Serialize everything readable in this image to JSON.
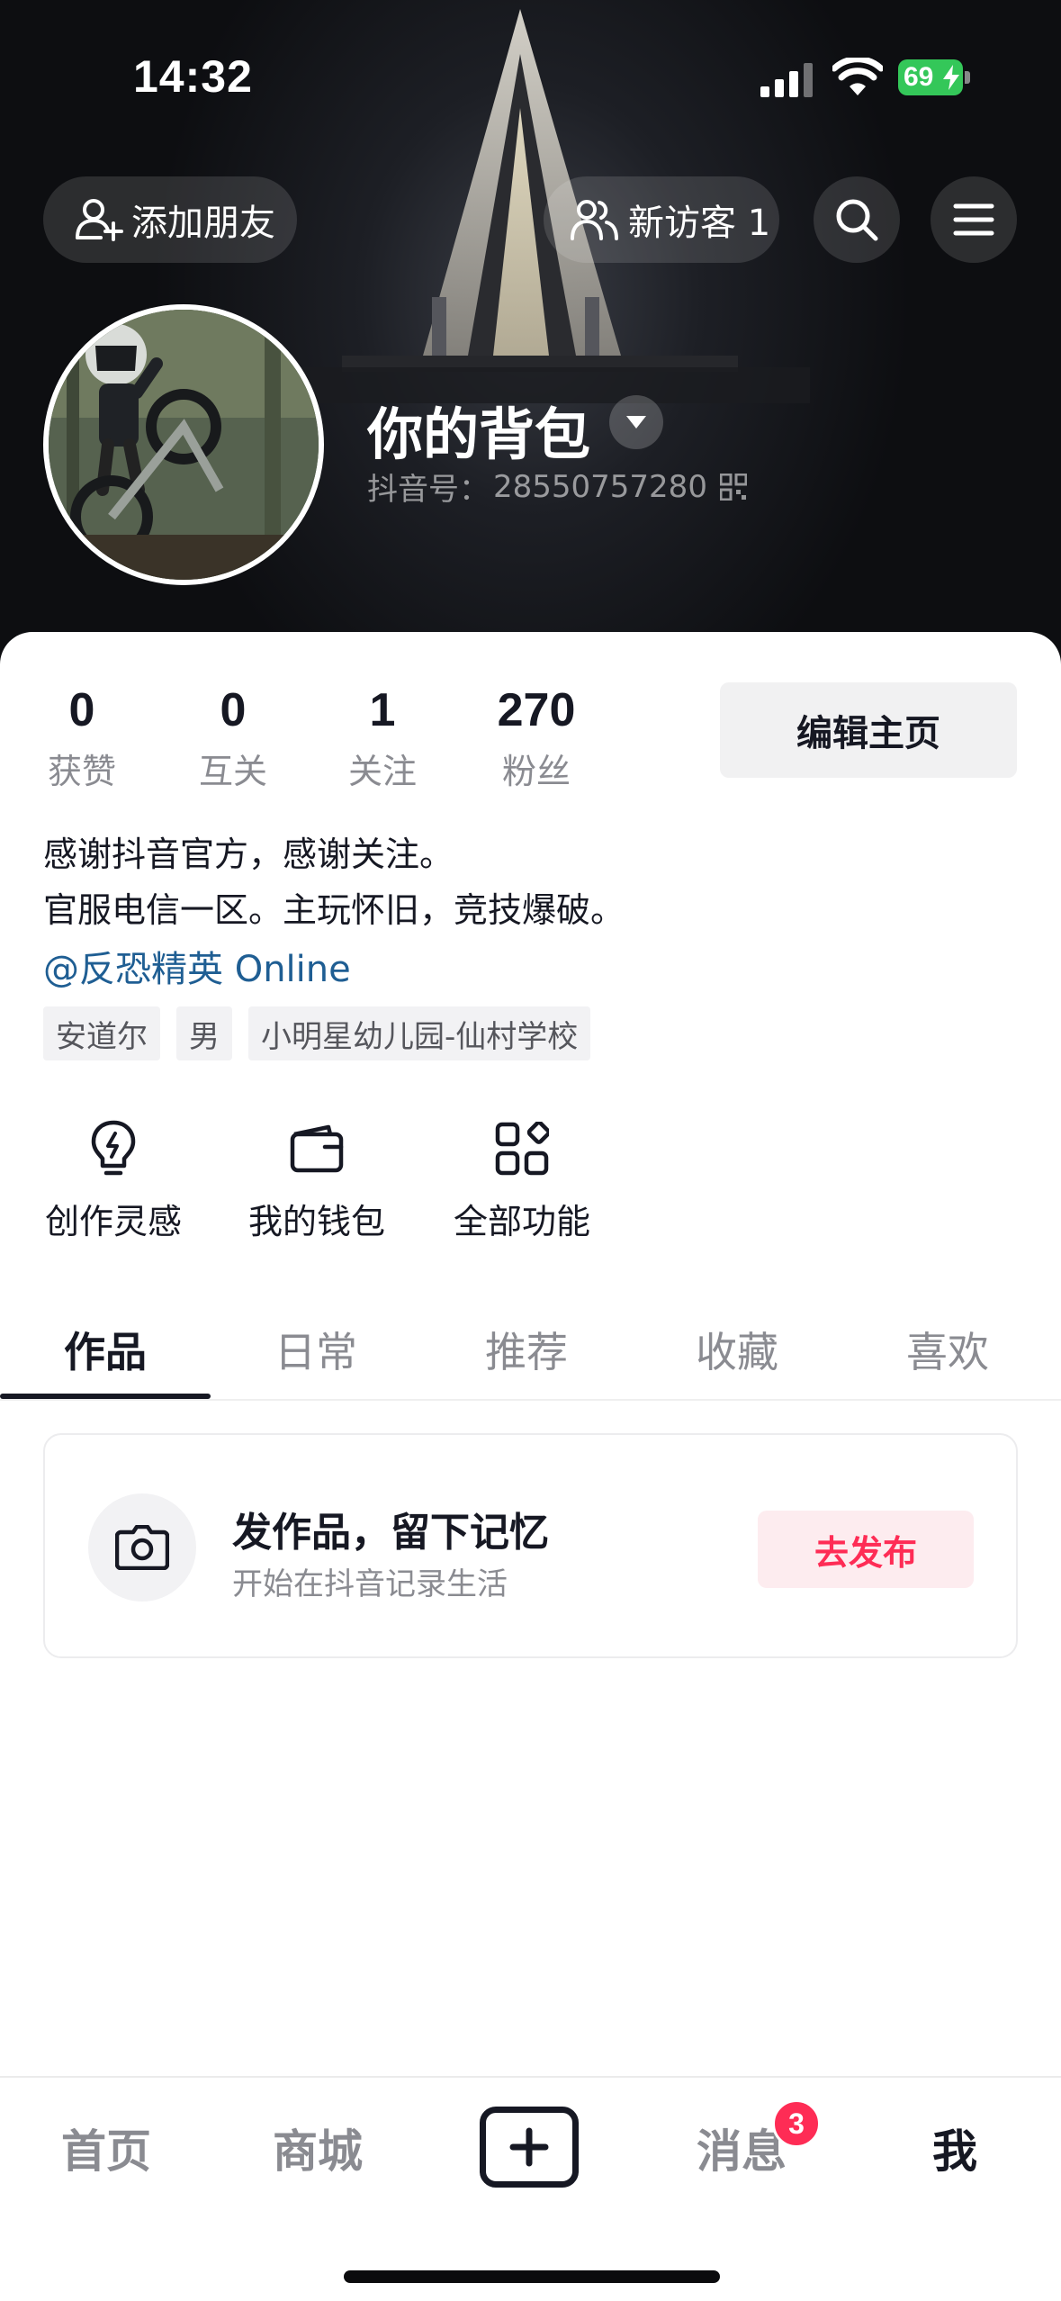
{
  "status_bar": {
    "time": "14:32",
    "battery": "69"
  },
  "header": {
    "add_friend": "添加朋友",
    "visitors": "新访客 1"
  },
  "profile": {
    "nickname": "你的背包",
    "id_label": "抖音号：",
    "id_value": "28550757280"
  },
  "stats": [
    {
      "value": "0",
      "label": "获赞"
    },
    {
      "value": "0",
      "label": "互关"
    },
    {
      "value": "1",
      "label": "关注"
    },
    {
      "value": "270",
      "label": "粉丝"
    }
  ],
  "edit_button": "编辑主页",
  "bio": {
    "line1": "感谢抖音官方，感谢关注。",
    "line2": "官服电信一区。主玩怀旧，竞技爆破。",
    "link": "@反恐精英 Online"
  },
  "tags": [
    "安道尔",
    "男",
    "小明星幼儿园-仙村学校"
  ],
  "functions": [
    {
      "label": "创作灵感",
      "icon": "lightbulb-icon"
    },
    {
      "label": "我的钱包",
      "icon": "wallet-icon"
    },
    {
      "label": "全部功能",
      "icon": "grid-icon"
    }
  ],
  "tabs": [
    "作品",
    "日常",
    "推荐",
    "收藏",
    "喜欢"
  ],
  "post_prompt": {
    "title": "发作品，留下记忆",
    "subtitle": "开始在抖音记录生活",
    "button": "去发布"
  },
  "bottom_nav": {
    "home": "首页",
    "mall": "商城",
    "messages": "消息",
    "me": "我",
    "message_badge": "3"
  },
  "colors": {
    "accent": "#fe2c55",
    "link": "#1f5e93",
    "battery": "#34c759"
  }
}
